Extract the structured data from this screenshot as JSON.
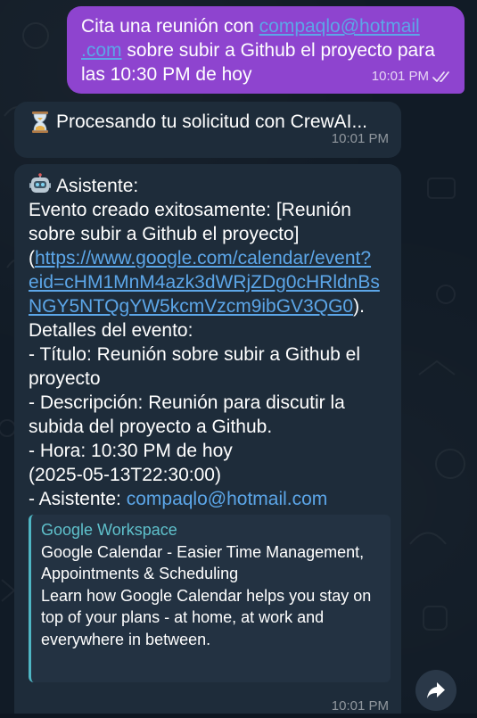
{
  "outgoing": {
    "text_before": "Cita una reunión con ",
    "email_part1": "compaqlo@hotmail",
    "email_part2": ".com",
    "text_after": " sobre subir a Github el proyecto para las 10:30 PM de hoy",
    "time": "10:01 PM",
    "status_icon": "double-check-icon"
  },
  "processing": {
    "icon": "hourglass-icon",
    "text": "Procesando tu solicitud con CrewAI...",
    "time": "10:01 PM"
  },
  "assistant": {
    "icon": "robot-icon",
    "sender": "Asistente:",
    "line_created_prefix": "Evento creado exitosamente: [Reunión sobre subir a Github el proyecto](",
    "event_link": "https://www.google.com/calendar/event?eid=cHM1MnM4azk3dWRjZDg0cHRldnBsNGY5NTQgYW5kcmVzcm9ibGV3QG0",
    "line_created_suffix": ").",
    "details_header": "Detalles del evento:",
    "title_line": "- Título: Reunión sobre subir a Github el proyecto",
    "description_line": "- Descripción: Reunión para discutir la subida del proyecto a Github.",
    "time_line1": "- Hora: 10:30 PM de hoy",
    "time_line2": "(2025-05-13T22:30:00)",
    "attendee_prefix": "- Asistente: ",
    "attendee_email": "compaqlo@hotmail.com",
    "time": "10:01 PM"
  },
  "link_preview": {
    "site_name": "Google Workspace",
    "title": "Google Calendar - Easier Time Management, Appointments & Scheduling",
    "description": "Learn how Google Calendar helps you stay on top of your plans - at home, at work and everywhere in between."
  },
  "forward_button": {
    "icon": "forward-arrow-icon"
  },
  "colors": {
    "outgoing_bubble": "#8e44cf",
    "incoming_bubble": "#1e2c3a",
    "link": "#5ca6e8",
    "preview_accent": "#4fb6c4"
  }
}
